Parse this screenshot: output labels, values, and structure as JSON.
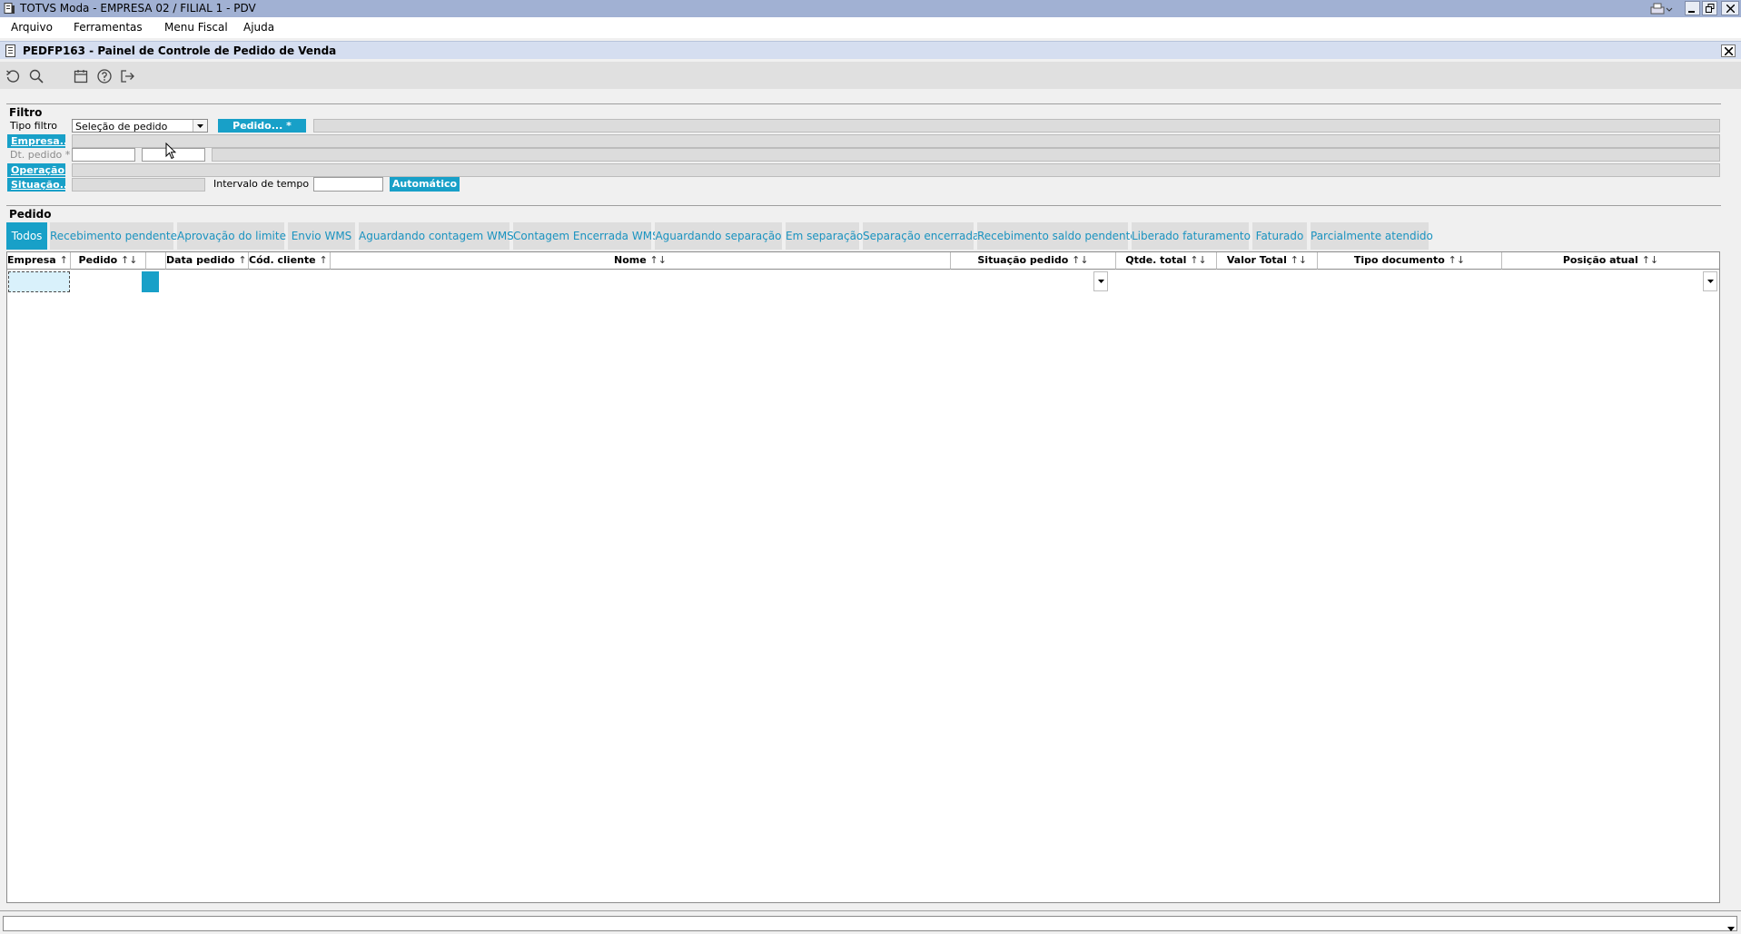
{
  "window": {
    "title": "TOTVS Moda - EMPRESA 02 / FILIAL 1 - PDV",
    "controls": [
      "printer-icon",
      "minimize-icon",
      "restore-icon",
      "close-icon"
    ]
  },
  "menu": {
    "items": [
      {
        "label": "Arquivo"
      },
      {
        "label": "Ferramentas"
      },
      {
        "label": "Menu Fiscal"
      },
      {
        "label": "Ajuda"
      }
    ]
  },
  "form": {
    "title": "PEDFP163 - Painel de Controle de Pedido de Venda",
    "toolbar": [
      "refresh-icon",
      "search-icon",
      "calendar-icon",
      "help-icon",
      "exit-icon"
    ]
  },
  "filter": {
    "section_title": "Filtro",
    "tipo_filtro_label": "Tipo filtro",
    "tipo_filtro_value": "Seleção de pedido",
    "pedido_button": "Pedido... *",
    "empresa_label": "Empresa... *",
    "dt_pedido_label": "Dt. pedido *",
    "operacao_label": "Operação...",
    "situacao_label": "Situação...",
    "intervalo_label": "Intervalo de tempo",
    "intervalo_value": "",
    "automatico_button": "Automático"
  },
  "pedido": {
    "section_title": "Pedido",
    "tabs": [
      {
        "label": "Todos",
        "active": true
      },
      {
        "label": "Recebimento pendente"
      },
      {
        "label": "Aprovação do limite"
      },
      {
        "label": "Envio WMS"
      },
      {
        "label": "Aguardando contagem WMS"
      },
      {
        "label": "Contagem Encerrada WMS"
      },
      {
        "label": "Aguardando separação"
      },
      {
        "label": "Em separação"
      },
      {
        "label": "Separação encerrada"
      },
      {
        "label": "Recebimento saldo pendente"
      },
      {
        "label": "Liberado faturamento"
      },
      {
        "label": "Faturado"
      },
      {
        "label": "Parcialmente atendido"
      }
    ],
    "columns": [
      {
        "label": "Empresa",
        "sort": "↑↓"
      },
      {
        "label": "Pedido",
        "sort": "↑↓"
      },
      {
        "label": "",
        "sort": ""
      },
      {
        "label": "Data pedido",
        "sort": "↑↓"
      },
      {
        "label": "Cód. cliente",
        "sort": "↑↓"
      },
      {
        "label": "Nome",
        "sort": "↑↓"
      },
      {
        "label": "Situação pedido",
        "sort": "↑↓"
      },
      {
        "label": "Qtde. total",
        "sort": "↑↓"
      },
      {
        "label": "Valor Total",
        "sort": "↑↓"
      },
      {
        "label": "Tipo documento",
        "sort": "↑↓"
      },
      {
        "label": "Posição atual",
        "sort": "↑↓"
      }
    ]
  },
  "colors": {
    "accent": "#18a0c8",
    "titlebar": "#a1b1d3",
    "tab_inactive_text": "#1a93c0"
  }
}
